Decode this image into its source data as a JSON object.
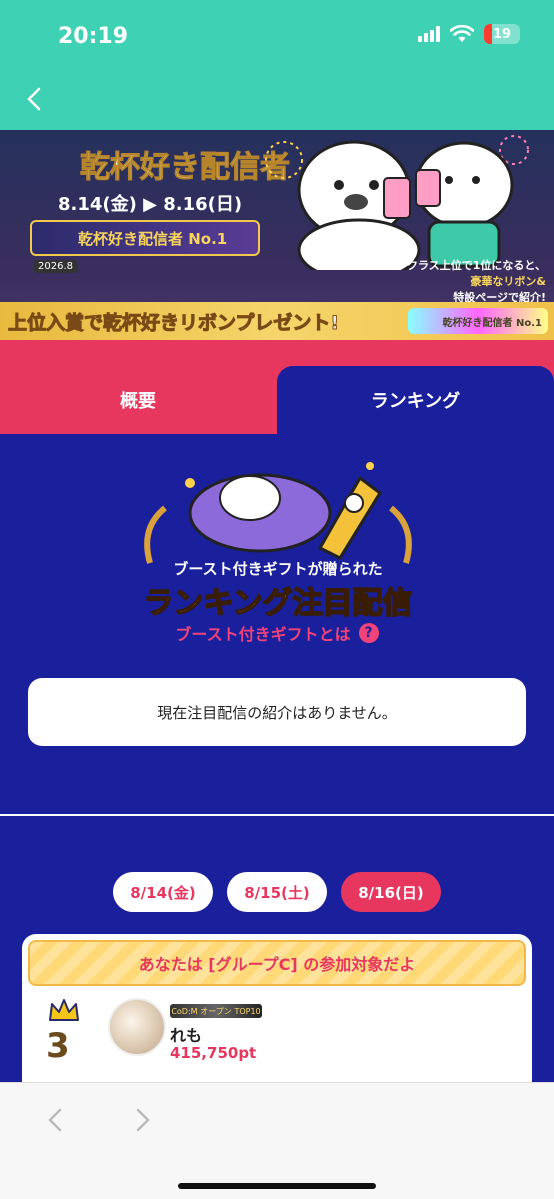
{
  "status_bar": {
    "time": "20:19",
    "battery": "19"
  },
  "banner": {
    "title": "乾杯好き配信者",
    "dates": "8.14(金) ▶ 8.16(日)",
    "badge_text": "乾杯好き配信者 No.1",
    "badge_year": "2026.8",
    "promo_line1": "ミラクラス上位で1位になると、",
    "promo_line2": "豪華なリボン&",
    "promo_line3": "特設ページで紹介!",
    "ribbon_text": "上位入賞で乾杯好きリボンプレゼント!",
    "ribbon_tag": "乾杯好き配信者 No.1"
  },
  "tabs": {
    "overview": "概要",
    "ranking": "ランキング"
  },
  "highlight": {
    "logo_line1": "ブースト付きギフトが贈られた",
    "logo_line2": "ランキング注目配信",
    "boost_link": "ブースト付きギフトとは",
    "help_icon": "?",
    "notice": "現在注目配信の紹介はありません。"
  },
  "date_tabs": [
    "8/14(金)",
    "8/15(土)",
    "8/16(日)"
  ],
  "group_banner": "あなたは [グループC] の参加対象だよ",
  "ranking_entry": {
    "rank": "3",
    "tag_left": "CoD:M",
    "tag_mid": "オープン",
    "tag_right": "TOP10",
    "name": "れも",
    "points": "415,750pt"
  },
  "colors": {
    "accent_pink": "#e8375f",
    "header_teal": "#3ed1b4",
    "main_blue": "#1a1f9c"
  }
}
